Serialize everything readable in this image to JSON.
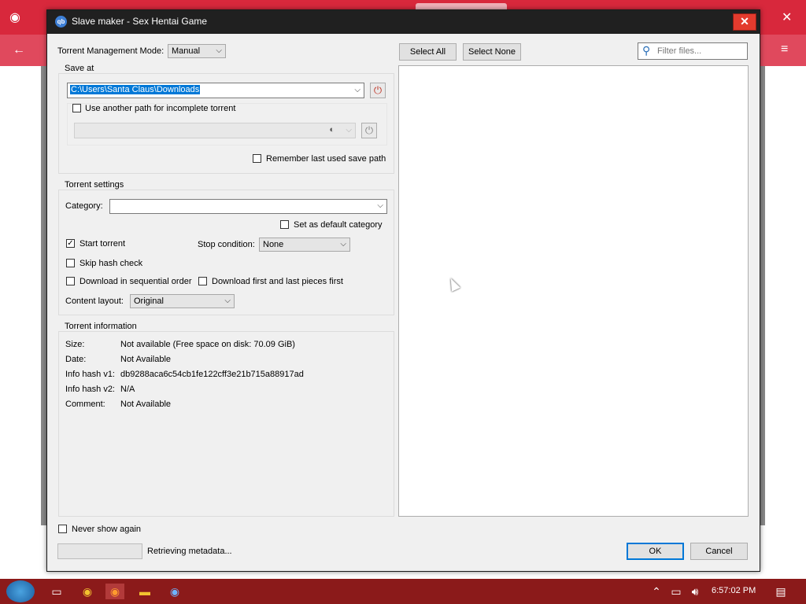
{
  "dialog": {
    "title": "Slave maker - Sex Hentai Game",
    "close_glyph": "✕",
    "app_icon_text": "qb",
    "management_mode_label": "Torrent Management Mode:",
    "management_mode_value": "Manual",
    "save_at": {
      "title": "Save at",
      "path": "C:\\Users\\Santa Claus\\Downloads",
      "use_another_path_label": "Use another path for incomplete torrent",
      "remember_label": "Remember last used save path"
    },
    "torrent_settings": {
      "title": "Torrent settings",
      "category_label": "Category:",
      "category_value": "",
      "set_default_label": "Set as default category",
      "start_torrent_label": "Start torrent",
      "start_torrent_checked": true,
      "stop_condition_label": "Stop condition:",
      "stop_condition_value": "None",
      "skip_hash_label": "Skip hash check",
      "sequential_label": "Download in sequential order",
      "first_last_label": "Download first and last pieces first",
      "content_layout_label": "Content layout:",
      "content_layout_value": "Original"
    },
    "torrent_info": {
      "title": "Torrent information",
      "rows": [
        {
          "label": "Size:",
          "value": "Not available (Free space on disk: 70.09 GiB)"
        },
        {
          "label": "Date:",
          "value": "Not Available"
        },
        {
          "label": "Info hash v1:",
          "value": "db9288aca6c54cb1fe122cff3e21b715a88917ad"
        },
        {
          "label": "Info hash v2:",
          "value": "N/A"
        },
        {
          "label": "Comment:",
          "value": "Not Available"
        }
      ]
    },
    "files": {
      "select_all": "Select All",
      "select_none": "Select None",
      "filter_placeholder": "Filter files..."
    },
    "never_show_label": "Never show again",
    "status_text": "Retrieving metadata...",
    "ok_label": "OK",
    "cancel_label": "Cancel"
  },
  "taskbar": {
    "time": "6:57:02 PM"
  },
  "colors": {
    "browser_red": "#d8283c",
    "taskbar": "#8b1a1a",
    "selection": "#0078d7"
  }
}
